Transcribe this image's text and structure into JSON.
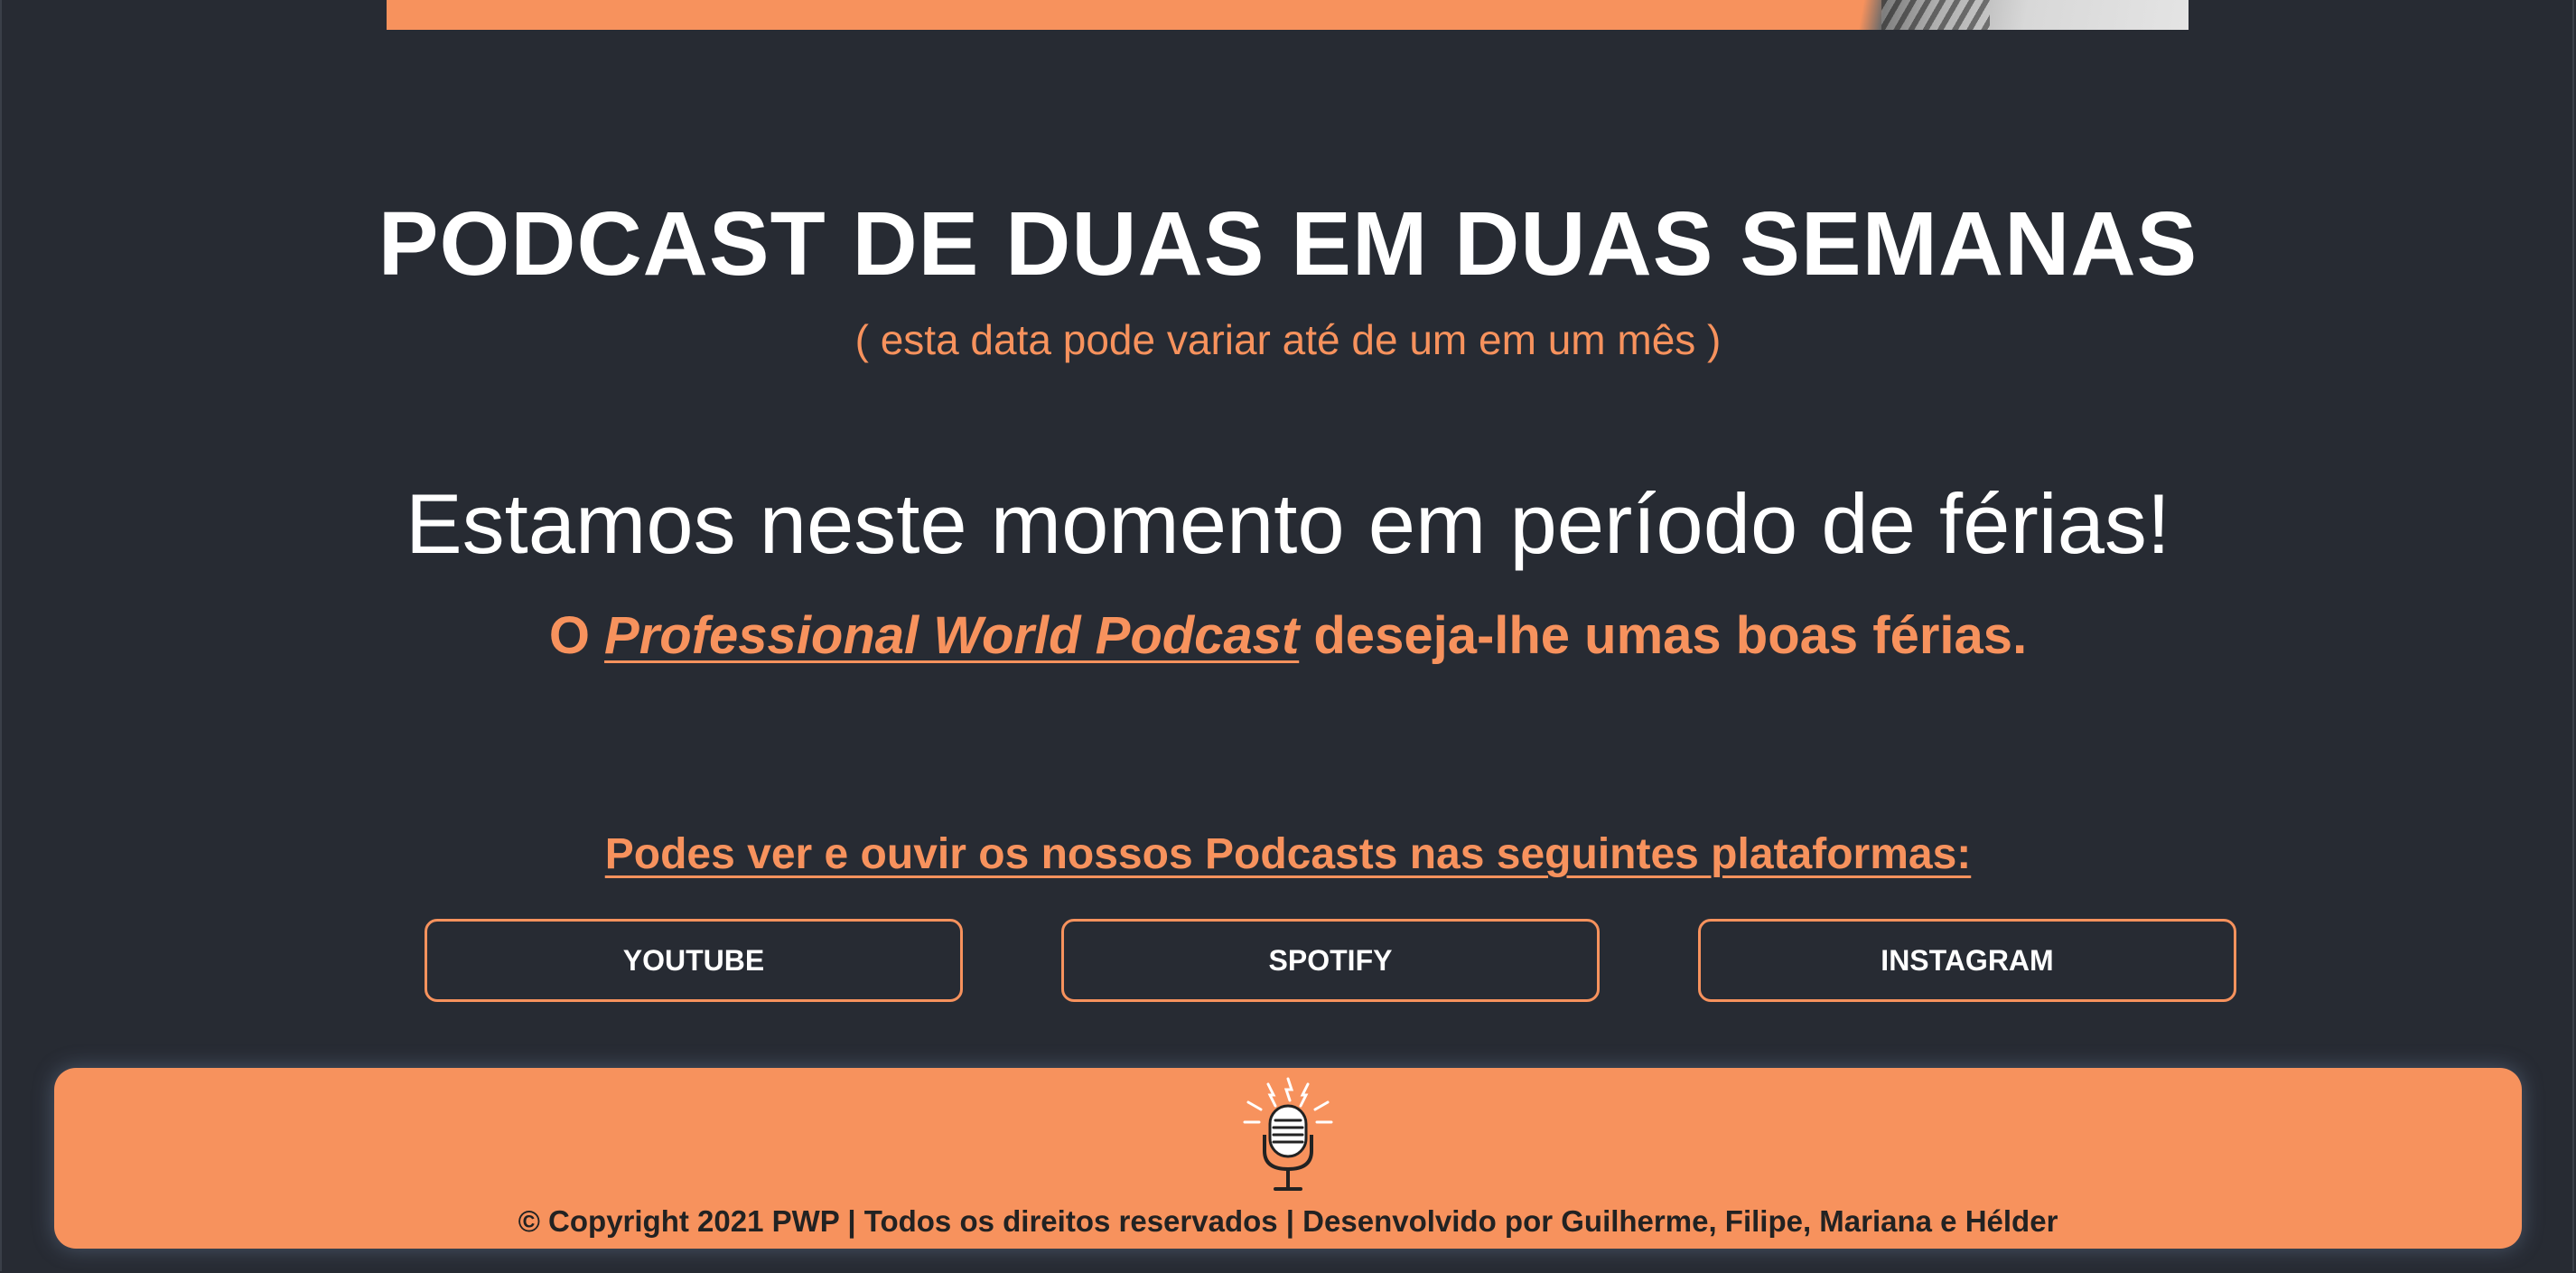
{
  "page": {
    "title": "PODCAST DE DUAS EM DUAS SEMANAS",
    "subtitle": "( esta data pode variar até de um em um mês )",
    "notice": "Estamos neste momento em período de férias!",
    "wish": {
      "prefix": "O ",
      "brand": "Professional World Podcast",
      "suffix": " deseja-lhe umas boas férias."
    },
    "platforms_heading": "Podes ver e ouvir os nossos Podcasts nas seguintes plataformas:",
    "platforms": [
      {
        "label": "YOUTUBE"
      },
      {
        "label": "SPOTIFY"
      },
      {
        "label": "INSTAGRAM"
      }
    ]
  },
  "footer": {
    "logo_icon": "microphone-icon",
    "copyright": "© Copyright 2021 PWP | Todos os direitos reservados | Desenvolvido por Guilherme, Filipe, Mariana e Hélder"
  },
  "colors": {
    "background": "#272b33",
    "accent": "#f7925d",
    "text": "#ffffff",
    "footer_text": "#222222"
  }
}
